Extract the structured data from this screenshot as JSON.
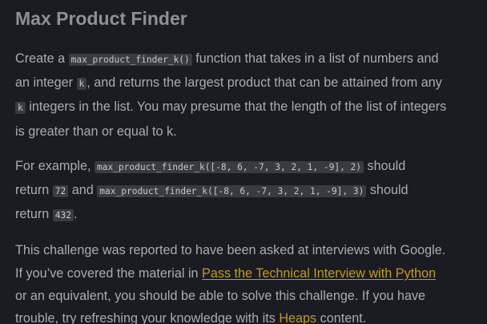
{
  "title": "Max Product Finder",
  "intro": {
    "t1": "Create a ",
    "code_fn": "max_product_finder_k()",
    "t2": " function that takes in a list of numbers and",
    "t3": "an integer ",
    "code_k1": "k",
    "t4": ", and returns the largest product that can be attained from any",
    "code_k2": "k",
    "t5": " integers in the list. You may presume that the length of the list of integers",
    "t6": "is greater than or equal to k."
  },
  "example": {
    "t1": "For example, ",
    "code_call1": "max_product_finder_k([-8, 6, -7, 3, 2, 1, -9], 2)",
    "t2": " should",
    "t3": "return ",
    "code_result1": "72",
    "t4": " and ",
    "code_call2": "max_product_finder_k([-8, 6, -7, 3, 2, 1, -9], 3)",
    "t5": " should",
    "t6": "return ",
    "code_result2": "432",
    "t7": "."
  },
  "note": {
    "t1": "This challenge was reported to have been asked at interviews with Google.",
    "t2": "If you’ve covered the material in ",
    "link_course": "Pass the Technical Interview with Python",
    "t3": "or an equivalent, you should be able to solve this challenge. If you have",
    "t4": "trouble, try refreshing your knowledge with its ",
    "link_heaps": "Heaps",
    "t5": " content."
  },
  "colors": {
    "background": "#1b1c22",
    "text": "#a9abb1",
    "title": "#8e9096",
    "code_bg": "#3a3b42",
    "link": "#c19b1d"
  }
}
